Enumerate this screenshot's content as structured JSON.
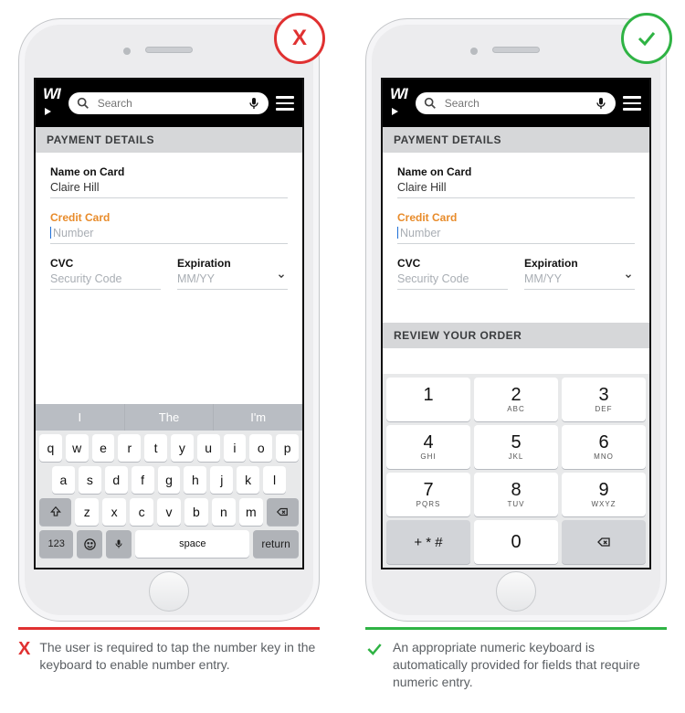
{
  "app": {
    "logo_text": "WI",
    "search_placeholder": "Search"
  },
  "section": {
    "payment_details": "PAYMENT DETAILS",
    "review_order": "REVIEW YOUR ORDER"
  },
  "fields": {
    "name_label": "Name on Card",
    "name_value": "Claire Hill",
    "card_label": "Credit Card",
    "card_placeholder": "Number",
    "cvc_label": "CVC",
    "cvc_placeholder": "Security Code",
    "exp_label": "Expiration",
    "exp_placeholder": "MM/YY"
  },
  "qwerty": {
    "suggestions": [
      "I",
      "The",
      "I'm"
    ],
    "row1": [
      "q",
      "w",
      "e",
      "r",
      "t",
      "y",
      "u",
      "i",
      "o",
      "p"
    ],
    "row2": [
      "a",
      "s",
      "d",
      "f",
      "g",
      "h",
      "j",
      "k",
      "l"
    ],
    "row3": [
      "z",
      "x",
      "c",
      "v",
      "b",
      "n",
      "m"
    ],
    "numbers_key": "123",
    "space_key": "space",
    "return_key": "return"
  },
  "numpad": {
    "keys": [
      {
        "n": "1",
        "l": ""
      },
      {
        "n": "2",
        "l": "ABC"
      },
      {
        "n": "3",
        "l": "DEF"
      },
      {
        "n": "4",
        "l": "GHI"
      },
      {
        "n": "5",
        "l": "JKL"
      },
      {
        "n": "6",
        "l": "MNO"
      },
      {
        "n": "7",
        "l": "PQRS"
      },
      {
        "n": "8",
        "l": "TUV"
      },
      {
        "n": "9",
        "l": "WXYZ"
      }
    ],
    "sym_key": "+ * #",
    "zero": "0"
  },
  "captions": {
    "bad": "The user is required to tap the number key in the keyboard to enable number entry.",
    "good": "An appropriate numeric keyboard is automatically provided for fields that require numeric entry."
  }
}
